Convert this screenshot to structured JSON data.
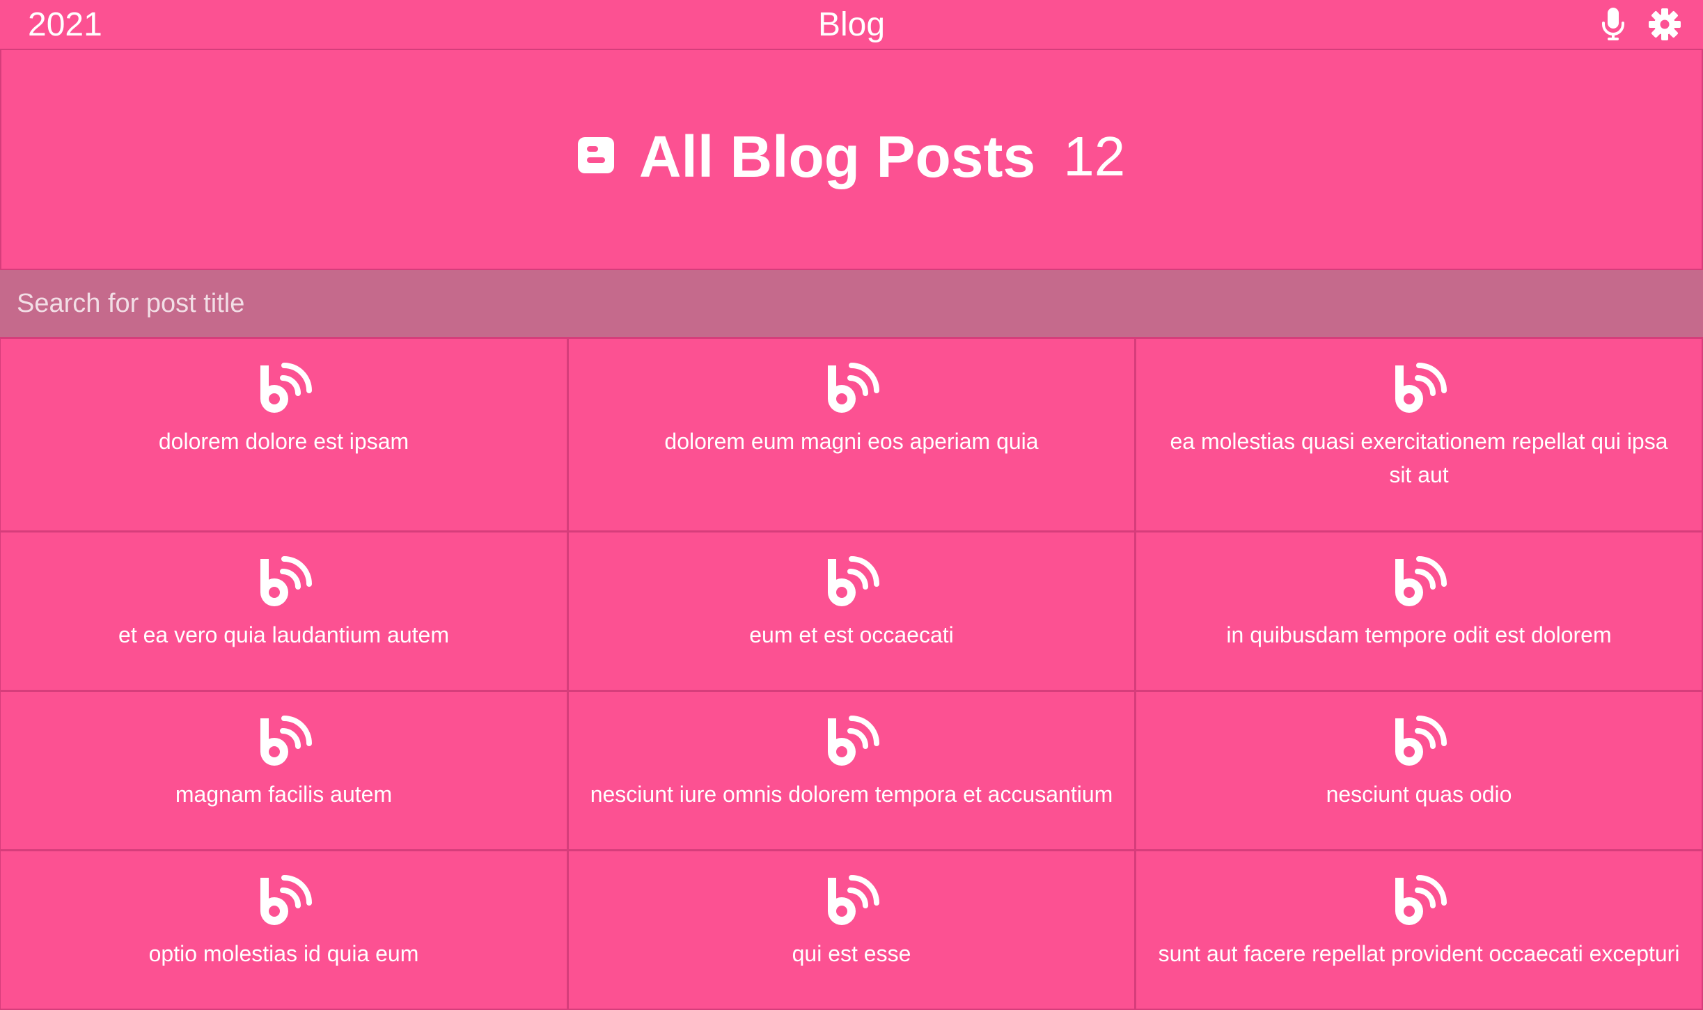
{
  "header": {
    "year": "2021",
    "title": "Blog",
    "icons": [
      "microphone-icon",
      "gear-icon"
    ]
  },
  "hero": {
    "icon": "blogger-icon",
    "title": "All Blog Posts",
    "count": "12"
  },
  "search": {
    "placeholder": "Search for post title",
    "value": ""
  },
  "posts": [
    {
      "title": "dolorem dolore est ipsam"
    },
    {
      "title": "dolorem eum magni eos aperiam quia"
    },
    {
      "title": "ea molestias quasi exercitationem repellat qui ipsa sit aut"
    },
    {
      "title": "et ea vero quia laudantium autem"
    },
    {
      "title": "eum et est occaecati"
    },
    {
      "title": "in quibusdam tempore odit est dolorem"
    },
    {
      "title": "magnam facilis autem"
    },
    {
      "title": "nesciunt iure omnis dolorem tempora et accusantium"
    },
    {
      "title": "nesciunt quas odio"
    },
    {
      "title": "optio molestias id quia eum"
    },
    {
      "title": "qui est esse"
    },
    {
      "title": "sunt aut facere repellat provident occaecati excepturi"
    }
  ],
  "colors": {
    "background": "#fc5192",
    "border": "#d63d7b",
    "search_bg": "#c56a8c",
    "text": "#ffffff"
  },
  "post_icon": "blog-rss-icon"
}
